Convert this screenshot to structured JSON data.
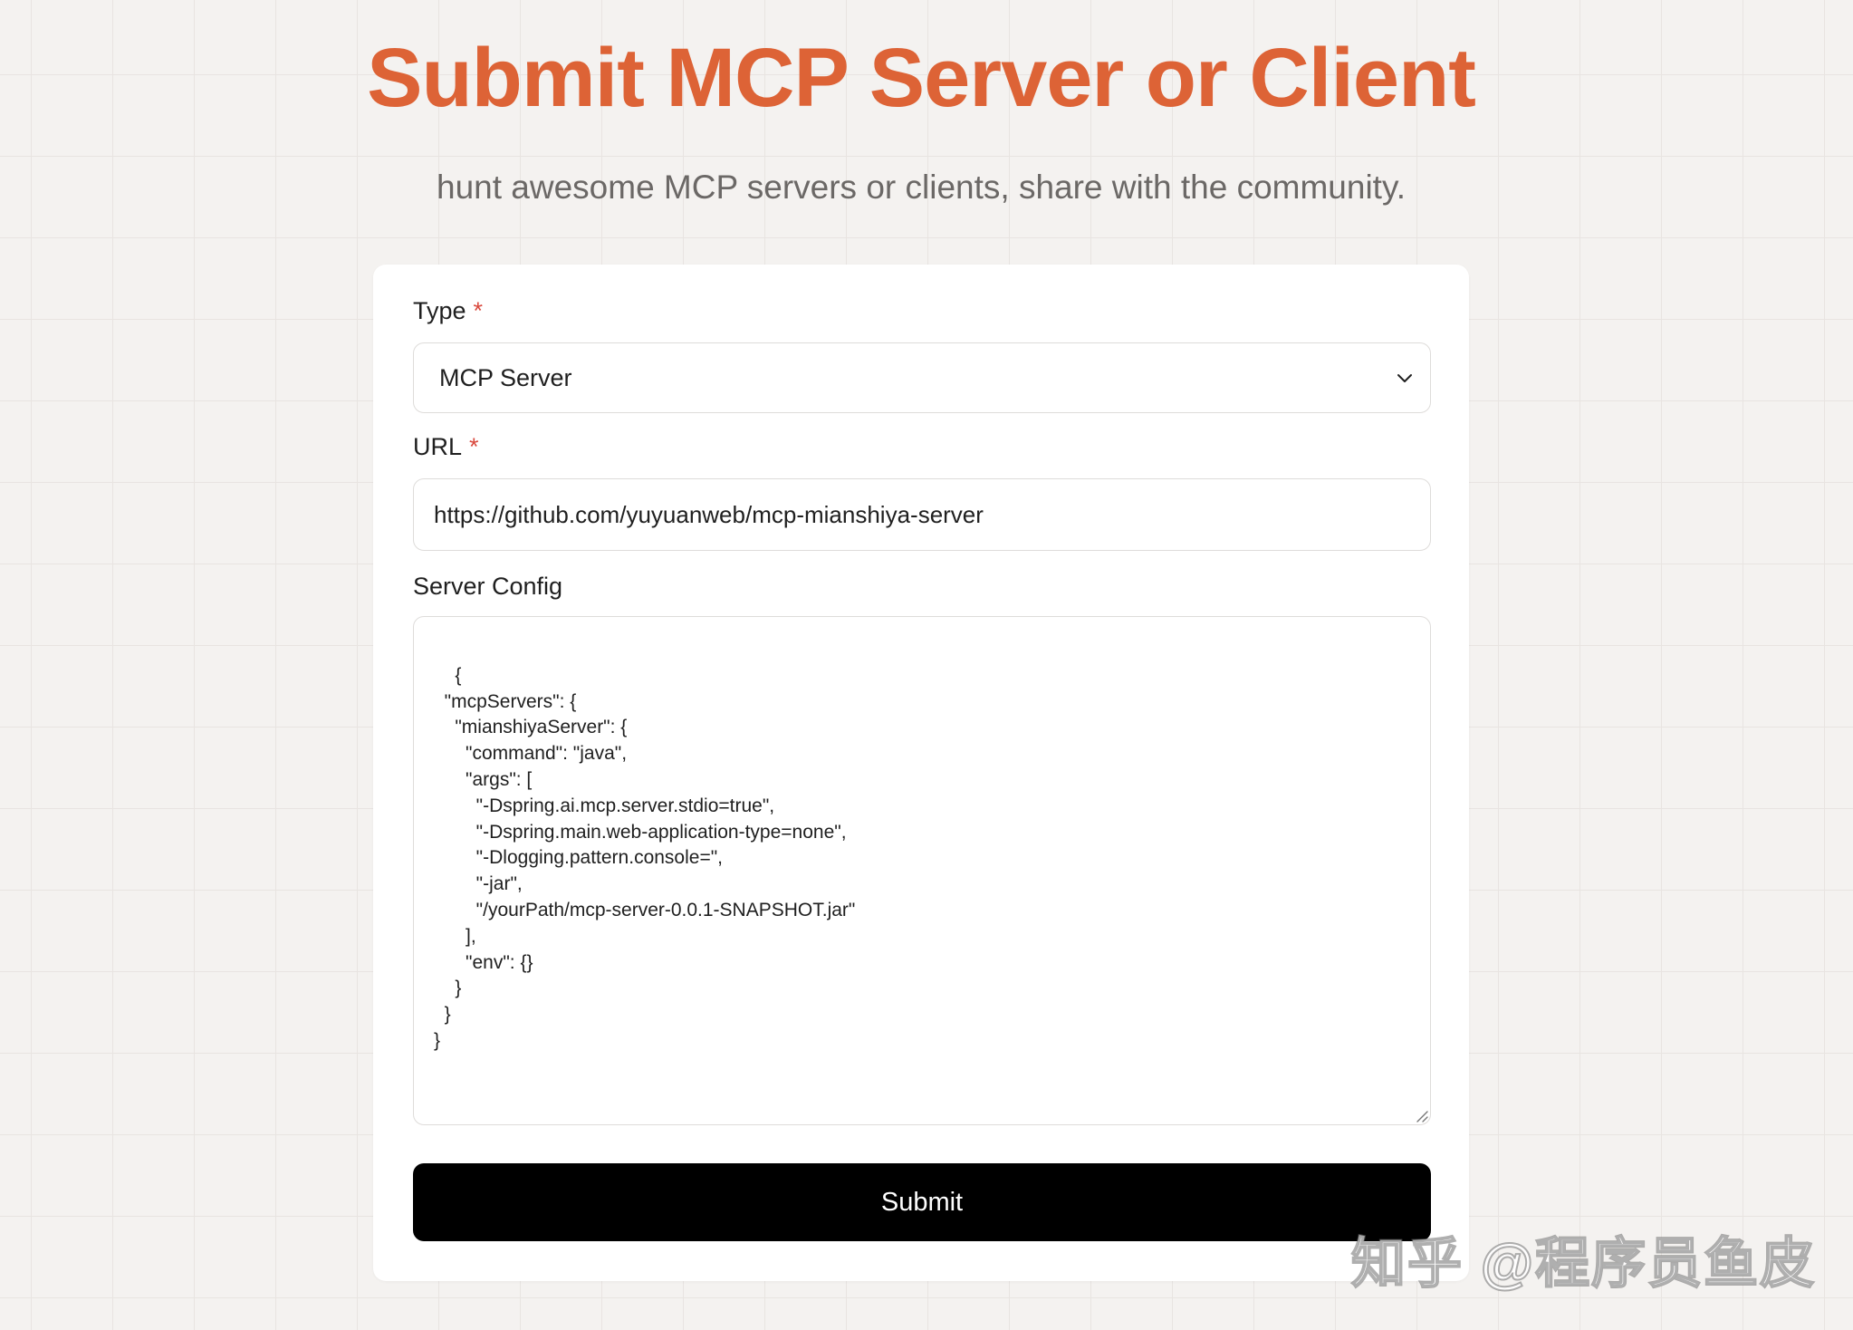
{
  "header": {
    "title": "Submit MCP Server or Client",
    "subtitle": "hunt awesome MCP servers or clients, share with the community."
  },
  "form": {
    "type_label": "Type",
    "type_required": "*",
    "type_value": "MCP Server",
    "url_label": "URL",
    "url_required": "*",
    "url_value": "https://github.com/yuyuanweb/mcp-mianshiya-server",
    "config_label": "Server Config",
    "config_value": "{\n  \"mcpServers\": {\n    \"mianshiyaServer\": {\n      \"command\": \"java\",\n      \"args\": [\n        \"-Dspring.ai.mcp.server.stdio=true\",\n        \"-Dspring.main.web-application-type=none\",\n        \"-Dlogging.pattern.console=\",\n        \"-jar\",\n        \"/yourPath/mcp-server-0.0.1-SNAPSHOT.jar\"\n      ],\n      \"env\": {}\n    }\n  }\n}",
    "submit_label": "Submit"
  },
  "watermark": "知乎 @程序员鱼皮",
  "icons": {
    "select": "chevron-down-icon",
    "textarea": "resize-handle-icon"
  },
  "colors": {
    "accent": "#dd6336",
    "required": "#d9493e",
    "button": "#000000",
    "background": "#f4f2f0"
  }
}
